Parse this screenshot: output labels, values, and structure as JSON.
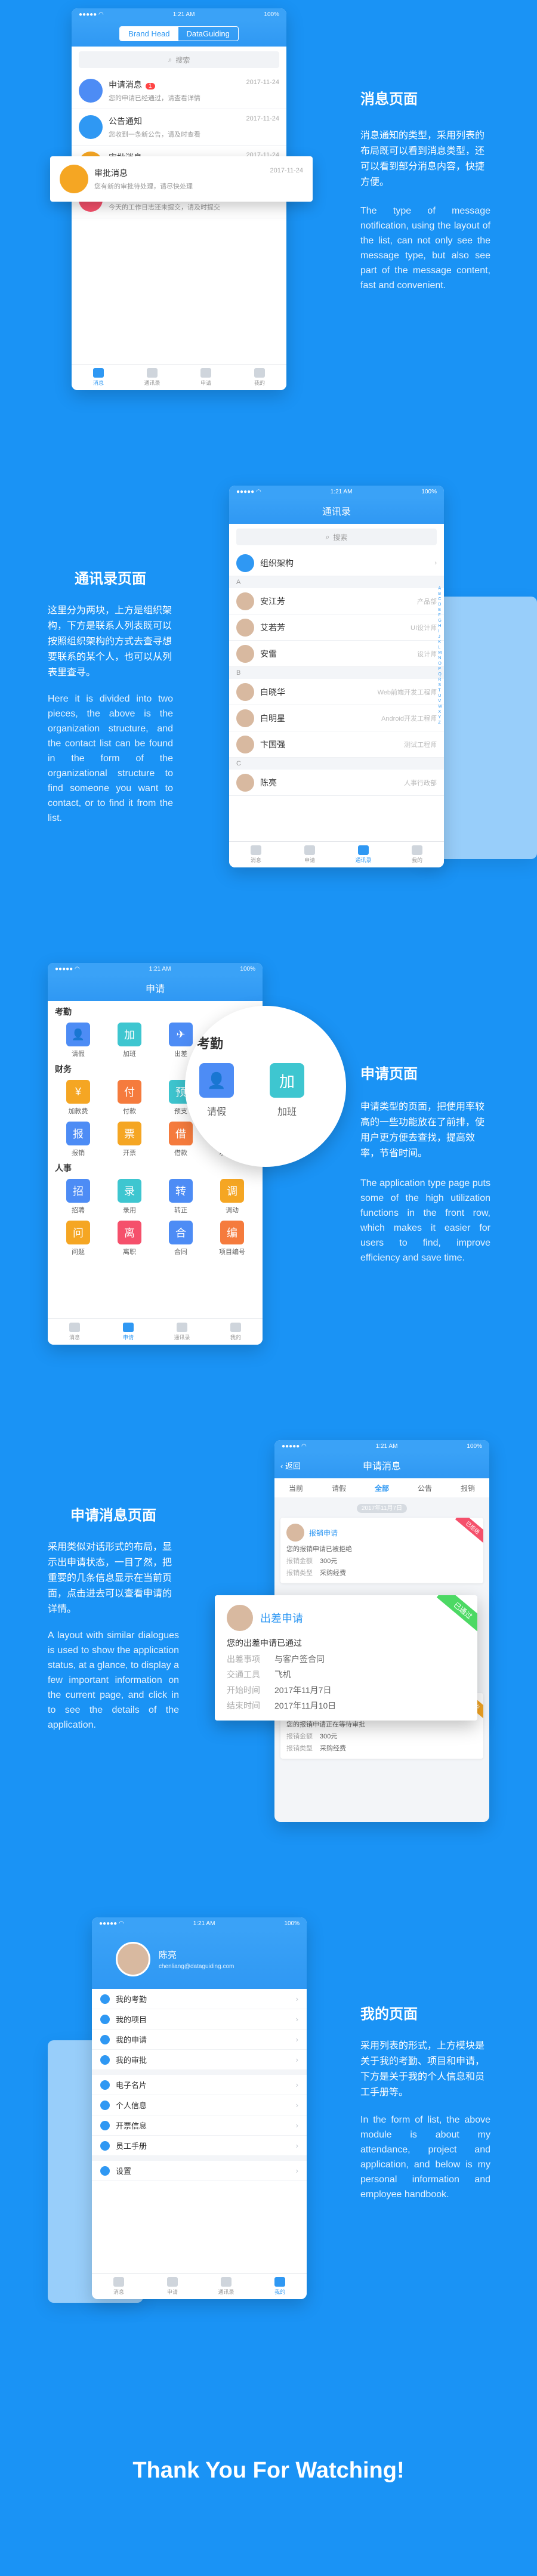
{
  "section1": {
    "title": "消息页面",
    "cn": "消息通知的类型，采用列表的布局既可以看到消息类型，还可以看到部分消息内容，快捷方便。",
    "en": "The type of message notification, using the layout of the list, can not only see the message type, but also see part of the message content, fast and convenient.",
    "phone": {
      "status_time": "1:21 AM",
      "status_batt": "100%",
      "seg_left": "Brand Head",
      "seg_right": "DataGuiding",
      "search": "搜索",
      "messages": [
        {
          "title": "申请消息",
          "time": "2017-11-24",
          "text": "您的申请已经通过，请查看详情",
          "badge": "1",
          "color": "#4d8cf5",
          "icon": "doc-icon"
        },
        {
          "title": "公告通知",
          "time": "2017-11-24",
          "text": "您收到一条新公告，请及时查看",
          "badge": "",
          "color": "#2f98f3",
          "icon": "speaker-icon"
        },
        {
          "title": "审批消息",
          "time": "2017-11-24",
          "text": "您有新的审批待处理，请尽快处理",
          "badge": "",
          "color": "#f5a623",
          "icon": "user-icon"
        },
        {
          "title": "提醒消息",
          "time": "2017-11-24",
          "text": "今天的工作日志还未提交，请及时提交",
          "badge": "",
          "color": "#f5506b",
          "icon": "bell-icon"
        }
      ],
      "tabs": [
        "消息",
        "通讯录",
        "申请",
        "我的"
      ]
    }
  },
  "section2": {
    "title": "通讯录页面",
    "cn": "这里分为两块，上方是组织架构，下方是联系人列表既可以按照组织架构的方式去查寻想要联系的某个人，也可以从列表里查寻。",
    "en": "Here it is divided into two pieces, the above is the organization structure, and the contact list can be found in the form of the organizational structure to find someone you want to contact, or to find it from the list.",
    "phone": {
      "status_time": "1:21 AM",
      "status_batt": "100%",
      "nav_title": "通讯录",
      "search": "搜索",
      "org": "组织架构",
      "groups": [
        {
          "letter": "A",
          "people": [
            {
              "name": "安江芳",
              "dept": "产品部"
            },
            {
              "name": "艾若芳",
              "dept": "UI设计师"
            },
            {
              "name": "安雷",
              "dept": "设计师"
            }
          ]
        },
        {
          "letter": "B",
          "people": [
            {
              "name": "白晓华",
              "dept": "Web前端开发工程师"
            },
            {
              "name": "白明星",
              "dept": "Android开发工程师"
            },
            {
              "name": "卞国强",
              "dept": "测试工程师"
            }
          ]
        },
        {
          "letter": "C",
          "people": [
            {
              "name": "陈亮",
              "dept": "人事行政部"
            }
          ]
        }
      ],
      "index": [
        "A",
        "B",
        "C",
        "D",
        "E",
        "F",
        "G",
        "H",
        "I",
        "J",
        "K",
        "L",
        "M",
        "N",
        "O",
        "P",
        "Q",
        "R",
        "S",
        "T",
        "U",
        "V",
        "W",
        "X",
        "Y",
        "Z"
      ],
      "tabs": [
        "消息",
        "申请",
        "通讯录",
        "我的"
      ]
    }
  },
  "section3": {
    "title": "申请页面",
    "cn": "申请类型的页面，把使用率较高的一些功能放在了前排，使用户更方便去查找，提高效率，节省时间。",
    "en": "The application type page puts some of the high utilization functions in the front row, which makes it easier for users to find, improve efficiency and save time.",
    "phone": {
      "status_time": "1:21 AM",
      "status_batt": "100%",
      "nav_title": "申请",
      "groups": [
        {
          "name": "考勤",
          "items": [
            {
              "label": "请假",
              "color": "#4d8cf5",
              "glyph": "👤"
            },
            {
              "label": "加班",
              "color": "#3ec6d0",
              "glyph": "加"
            },
            {
              "label": "出差",
              "color": "#4d8cf5",
              "glyph": "✈"
            }
          ]
        },
        {
          "name": "财务",
          "items": [
            {
              "label": "加款费",
              "color": "#f5a623",
              "glyph": "¥"
            },
            {
              "label": "付款",
              "color": "#f57b3d",
              "glyph": "付"
            },
            {
              "label": "预支",
              "color": "#3ec6d0",
              "glyph": "预"
            },
            {
              "label": "物品领用",
              "color": "#f5506b",
              "glyph": "物"
            },
            {
              "label": "报销",
              "color": "#4d8cf5",
              "glyph": "报"
            },
            {
              "label": "开票",
              "color": "#f5a623",
              "glyph": "票"
            },
            {
              "label": "借款",
              "color": "#f57b3d",
              "glyph": "借"
            },
            {
              "label": "项目报账",
              "color": "#3ec6d0",
              "glyph": "项"
            }
          ]
        },
        {
          "name": "人事",
          "items": [
            {
              "label": "招聘",
              "color": "#4d8cf5",
              "glyph": "招"
            },
            {
              "label": "录用",
              "color": "#3ec6d0",
              "glyph": "录"
            },
            {
              "label": "转正",
              "color": "#4d8cf5",
              "glyph": "转"
            },
            {
              "label": "调动",
              "color": "#f5a623",
              "glyph": "调"
            },
            {
              "label": "问题",
              "color": "#f5a623",
              "glyph": "问"
            },
            {
              "label": "离职",
              "color": "#f5506b",
              "glyph": "离"
            },
            {
              "label": "合同",
              "color": "#4d8cf5",
              "glyph": "合"
            },
            {
              "label": "项目编号",
              "color": "#f57b3d",
              "glyph": "编"
            }
          ]
        }
      ],
      "zoom_title": "考勤",
      "zoom_items": [
        {
          "label": "请假",
          "color": "#4d8cf5",
          "glyph": "👤"
        },
        {
          "label": "加班",
          "color": "#3ec6d0",
          "glyph": "加"
        }
      ],
      "tabs": [
        "消息",
        "申请",
        "通讯录",
        "我的"
      ]
    }
  },
  "section4": {
    "title": "申请消息页面",
    "cn": "采用类似对话形式的布局，显示出申请状态，一目了然，把重要的几条信息显示在当前页面，点击进去可以查看申请的详情。",
    "en": "A layout with similar dialogues is used to show the application status, at a glance, to display a few important information on the current page, and click in to see the details of the application.",
    "phone": {
      "status_time": "1:21 AM",
      "status_batt": "100%",
      "back": "返回",
      "nav_title": "申请消息",
      "filters": [
        "当前",
        "请假",
        "全部",
        "公告",
        "报销"
      ],
      "date": "2017年11月7日",
      "cards": [
        {
          "name": "报销申请",
          "text": "您的报销申请已被拒绝",
          "amount_label": "报销金额",
          "amount": "300元",
          "type_label": "报销类型",
          "type": "采购经费",
          "stamp": "已拒绝",
          "stamp_color": "#f5506b"
        },
        {
          "name": "报销申请",
          "text": "您的报销申请正在等待审批",
          "amount_label": "报销金额",
          "amount": "300元",
          "type_label": "报销类型",
          "type": "采购经费",
          "stamp": "审批中",
          "stamp_color": "#f5a623"
        }
      ],
      "popup": {
        "name": "出差申请",
        "text": "您的出差申请已通过",
        "rows": [
          {
            "label": "出差事项",
            "value": "与客户签合同"
          },
          {
            "label": "交通工具",
            "value": "飞机"
          },
          {
            "label": "开始时间",
            "value": "2017年11月7日"
          },
          {
            "label": "结束时间",
            "value": "2017年11月10日"
          }
        ],
        "stamp": "已通过",
        "stamp_color": "#4cd964"
      }
    }
  },
  "section5": {
    "title": "我的页面",
    "cn": "采用列表的形式，上方模块是关于我的考勤、项目和申请，下方是关于我的个人信息和员工手册等。",
    "en": "In the form of list, the above module is about my attendance, project and application, and below is my personal information and employee handbook.",
    "phone": {
      "status_time": "1:21 AM",
      "status_batt": "100%",
      "user_name": "陈亮",
      "user_email": "chenliang@dataguiding.com",
      "menu1": [
        "我的考勤",
        "我的项目",
        "我的申请",
        "我的审批"
      ],
      "menu2": [
        "电子名片",
        "个人信息",
        "开票信息",
        "员工手册"
      ],
      "menu3": [
        "设置"
      ],
      "tabs": [
        "消息",
        "申请",
        "通讯录",
        "我的"
      ]
    }
  },
  "footer": {
    "thanks": "Thank You For Watching!"
  }
}
